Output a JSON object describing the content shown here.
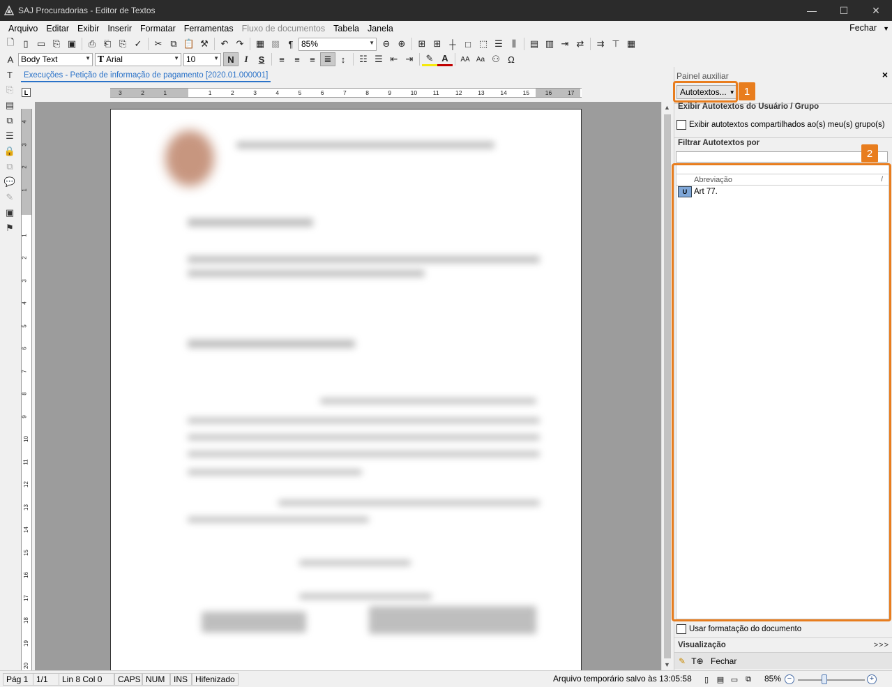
{
  "window": {
    "title": "SAJ Procuradorias - Editor de Textos",
    "minimize": "—",
    "maximize": "☐",
    "close": "✕"
  },
  "menu": {
    "items": [
      {
        "label": "Arquivo",
        "disabled": false
      },
      {
        "label": "Editar",
        "disabled": false
      },
      {
        "label": "Exibir",
        "disabled": false
      },
      {
        "label": "Inserir",
        "disabled": false
      },
      {
        "label": "Formatar",
        "disabled": false
      },
      {
        "label": "Ferramentas",
        "disabled": false
      },
      {
        "label": "Fluxo de documentos",
        "disabled": true
      },
      {
        "label": "Tabela",
        "disabled": false
      },
      {
        "label": "Janela",
        "disabled": false
      }
    ],
    "right": "Fechar"
  },
  "toolbar": {
    "zoom_value": "85%",
    "style_value": "Body Text",
    "font_value": "Arial",
    "size_value": "10",
    "bold": "N",
    "italic": "I",
    "strike": "S",
    "pilcrow": "¶"
  },
  "document": {
    "tab_label": "Execuções - Petição de informação de pagamento [2020.01.000001]",
    "ruler_corner": "L"
  },
  "panel": {
    "title": "Painel auxiliar",
    "close": "×",
    "autotext_button": "Autotextos...",
    "section_user_group": "Exibir Autotextos do Usuário / Grupo",
    "shared_checkbox_label": "Exibir autotextos compartilhados ao(s) meu(s) grupo(s)",
    "filter_header": "Filtrar Autotextos por",
    "filter_value": "",
    "list_column": "Abreviação",
    "list_sort_marker": "/",
    "rows": [
      {
        "abbr": "Art 77.",
        "icon": "U"
      }
    ],
    "use_format_label": "Usar formatação do documento",
    "visualization_header": "Visualização",
    "visualization_more": ">>>",
    "footer_close": "Fechar",
    "callouts": [
      {
        "number": "1"
      },
      {
        "number": "2"
      }
    ],
    "accent_color": "#e87d1e"
  },
  "status": {
    "page": "Pág 1",
    "pages": "1/1",
    "line_col": "Lin 8  Col 0",
    "caps": "CAPS",
    "num": "NUM",
    "ins": "INS",
    "hyphen": "Hifenizado",
    "saved": "Arquivo temporário salvo às 13:05:58",
    "zoom": "85%"
  }
}
